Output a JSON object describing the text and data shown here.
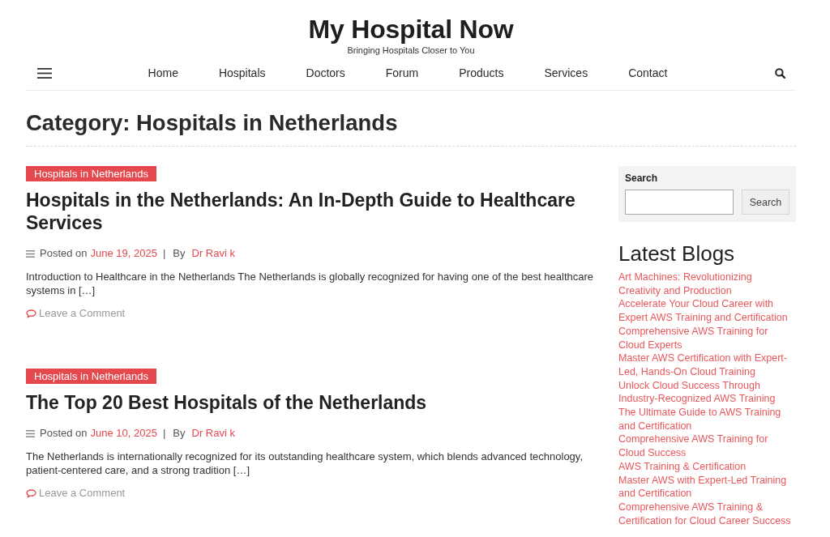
{
  "site": {
    "title": "My Hospital Now",
    "tagline": "Bringing Hospitals Closer to You"
  },
  "nav": {
    "items": [
      {
        "label": "Home"
      },
      {
        "label": "Hospitals"
      },
      {
        "label": "Doctors"
      },
      {
        "label": "Forum"
      },
      {
        "label": "Products"
      },
      {
        "label": "Services"
      },
      {
        "label": "Contact"
      }
    ]
  },
  "page_title": "Category: Hospitals in Netherlands",
  "posts": [
    {
      "category": "Hospitals in Netherlands",
      "title": "Hospitals in the Netherlands: An In-Depth Guide to Healthcare Services",
      "posted_label": "Posted on",
      "date": "June 19, 2025",
      "separator": "|",
      "by_label": "By",
      "author": "Dr Ravi k",
      "excerpt": "Introduction to Healthcare in the Netherlands The Netherlands is globally recognized for having one of the best healthcare systems in […]",
      "comments_link": "Leave a Comment"
    },
    {
      "category": "Hospitals in Netherlands",
      "title": "The Top 20 Best Hospitals of the Netherlands",
      "posted_label": "Posted on",
      "date": "June 10, 2025",
      "separator": "|",
      "by_label": "By",
      "author": "Dr Ravi k",
      "excerpt": "The Netherlands is internationally recognized for its outstanding healthcare system, which blends advanced technology, patient-centered care, and a strong tradition […]",
      "comments_link": "Leave a Comment"
    }
  ],
  "sidebar": {
    "search": {
      "label": "Search",
      "button": "Search"
    },
    "latest_blogs": {
      "title": "Latest Blogs",
      "items": [
        "Art Machines: Revolutionizing Creativity and Production",
        "Accelerate Your Cloud Career with Expert AWS Training and Certification",
        "Comprehensive AWS Training for Cloud Experts",
        "Master AWS Certification with Expert-Led, Hands-On Cloud Training",
        "Unlock Cloud Success Through Industry-Recognized AWS Training",
        "The Ultimate Guide to AWS Training and Certification",
        "Comprehensive AWS Training for Cloud Success",
        "AWS Training & Certification",
        "Master AWS with Expert-Led Training and Certification",
        "Comprehensive AWS Training & Certification for Cloud Career Success"
      ]
    }
  }
}
